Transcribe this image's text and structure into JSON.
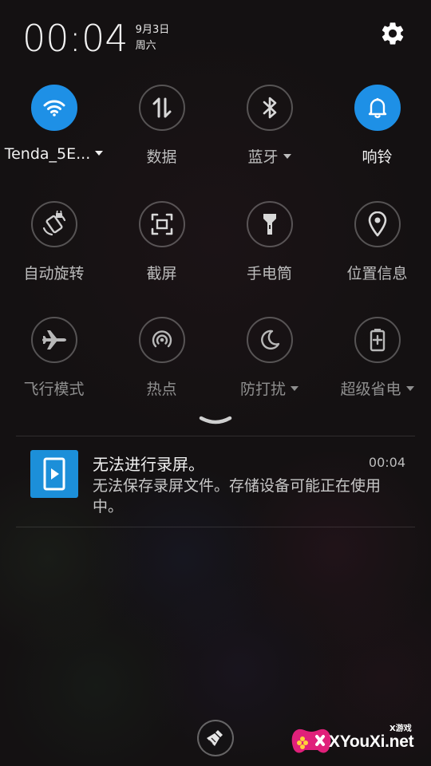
{
  "status": {
    "clock": "00:04",
    "date": "9月3日",
    "weekday": "周六"
  },
  "quick_settings": {
    "tiles": [
      {
        "label": "Tenda_5E...",
        "icon": "wifi-icon",
        "active": true,
        "dropdown": true
      },
      {
        "label": "数据",
        "icon": "data-arrows-icon",
        "active": false,
        "dropdown": false
      },
      {
        "label": "蓝牙",
        "icon": "bluetooth-icon",
        "active": false,
        "dropdown": true
      },
      {
        "label": "响铃",
        "icon": "bell-icon",
        "active": true,
        "dropdown": false
      },
      {
        "label": "自动旋转",
        "icon": "rotate-lock-icon",
        "active": false,
        "dropdown": false
      },
      {
        "label": "截屏",
        "icon": "screenshot-icon",
        "active": false,
        "dropdown": false
      },
      {
        "label": "手电筒",
        "icon": "flashlight-icon",
        "active": false,
        "dropdown": false
      },
      {
        "label": "位置信息",
        "icon": "location-pin-icon",
        "active": false,
        "dropdown": false
      },
      {
        "label": "飞行模式",
        "icon": "airplane-icon",
        "active": false,
        "dropdown": false
      },
      {
        "label": "热点",
        "icon": "hotspot-icon",
        "active": false,
        "dropdown": false
      },
      {
        "label": "防打扰",
        "icon": "moon-icon",
        "active": false,
        "dropdown": true
      },
      {
        "label": "超级省电",
        "icon": "battery-plus-icon",
        "active": false,
        "dropdown": true
      }
    ]
  },
  "notification": {
    "icon": "screen-record-icon",
    "title": "无法进行录屏。",
    "time": "00:04",
    "body": "无法保存录屏文件。存储设备可能正在使用中。"
  },
  "watermark": {
    "site": "XYouXi.net",
    "tag": "X游戏"
  },
  "colors": {
    "accent": "#1e90e6",
    "background": "#141112"
  }
}
